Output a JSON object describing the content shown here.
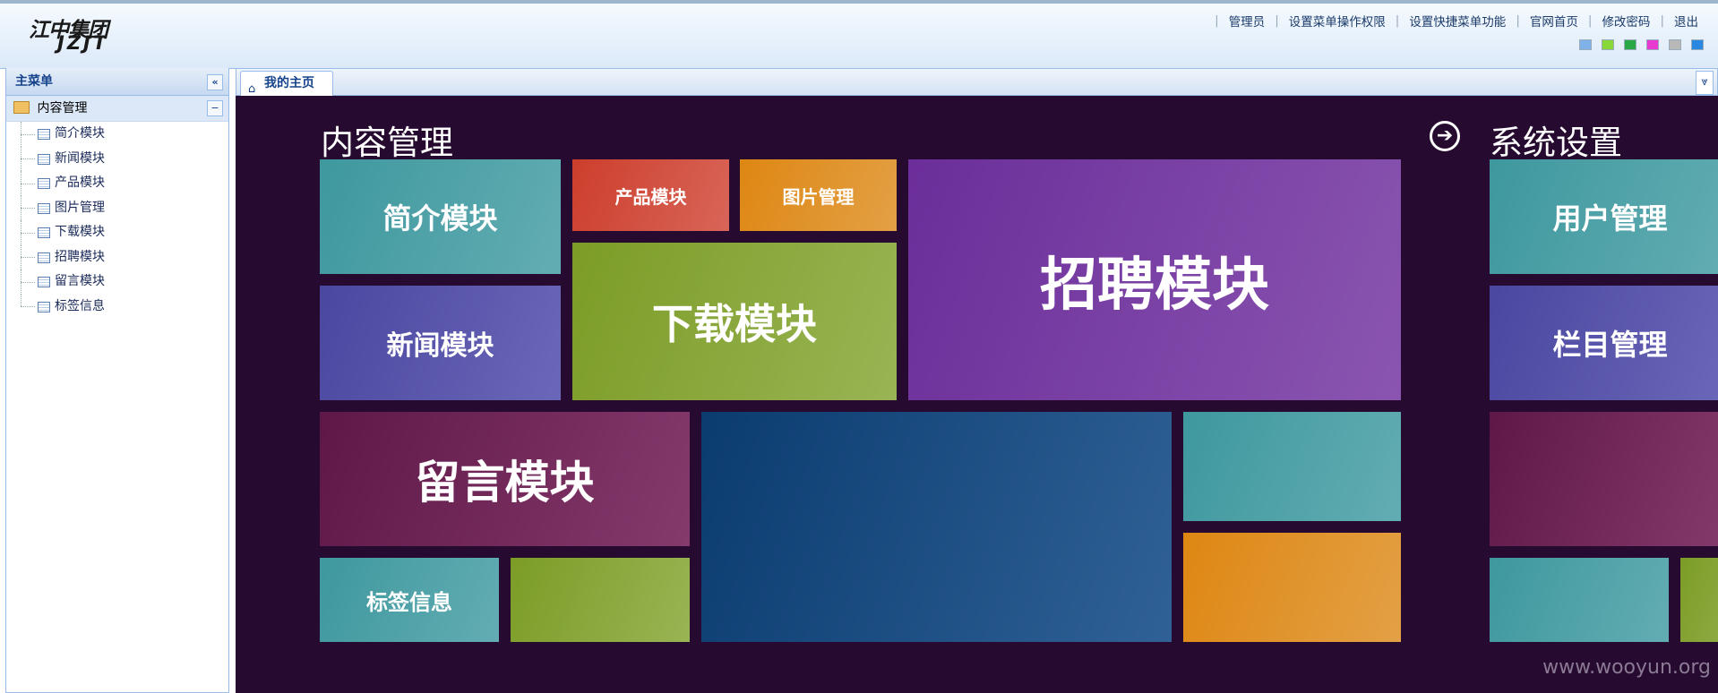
{
  "header": {
    "logo_line1": "江中集团",
    "logo_line2": "JZJT",
    "links": [
      "管理员",
      "设置菜单操作权限",
      "设置快捷菜单功能",
      "官网首页",
      "修改密码",
      "退出"
    ],
    "skin_colors": [
      "#7fb2e8",
      "#88d83a",
      "#2aa845",
      "#e83ad0",
      "#b8b8b8",
      "#2a88e0"
    ]
  },
  "sidebar": {
    "title": "主菜单",
    "collapse_icon": "double-chevron-left-icon",
    "root": {
      "label": "内容管理",
      "icon": "folder-icon",
      "toggle": "−"
    },
    "items": [
      {
        "label": "简介模块"
      },
      {
        "label": "新闻模块"
      },
      {
        "label": "产品模块"
      },
      {
        "label": "图片管理"
      },
      {
        "label": "下载模块"
      },
      {
        "label": "招聘模块"
      },
      {
        "label": "留言模块"
      },
      {
        "label": "标签信息"
      }
    ]
  },
  "tabs": {
    "home_label": "我的主页",
    "home_icon": "home-icon",
    "scroll_icon": "double-chevron-down-icon"
  },
  "metro": {
    "background": "#260a30",
    "section1_title": "内容管理",
    "section2_title": "系统设置",
    "arrow_icon": "arrow-right-circle-icon",
    "tiles": {
      "intro": "简介模块",
      "product": "产品模块",
      "picture": "图片管理",
      "recruit": "招聘模块",
      "news": "新闻模块",
      "download": "下载模块",
      "message": "留言模块",
      "tags": "标签信息",
      "users": "用户管理",
      "columns": "栏目管理"
    },
    "watermark": "www.wooyun.org"
  }
}
